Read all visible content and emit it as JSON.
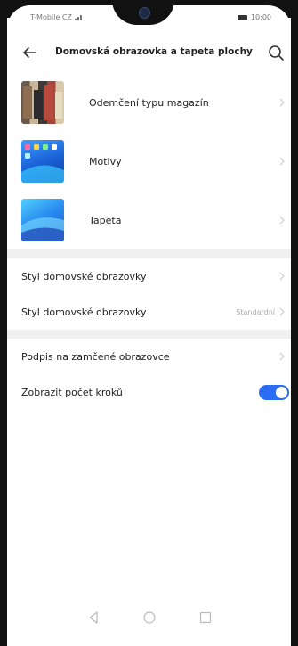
{
  "status_bar": {
    "carrier": "T-Mobile CZ",
    "time": "10:00"
  },
  "header": {
    "title": "Domovská obrazovka a tapeta plochy"
  },
  "items_with_images": [
    {
      "label": "Odemčení typu magazín",
      "icon": "magazine-thumbnail"
    },
    {
      "label": "Motivy",
      "icon": "themes-thumbnail"
    },
    {
      "label": "Tapeta",
      "icon": "wallpaper-thumbnail"
    }
  ],
  "home_section": [
    {
      "label": "Styl domovské obrazovky",
      "value": ""
    },
    {
      "label": "Styl domovské obrazovky",
      "value": "Standardní"
    }
  ],
  "lock_section": [
    {
      "label": "Podpis na zamčené obrazovce"
    },
    {
      "label": "Zobrazit počet kroků",
      "toggle": true
    }
  ],
  "colors": {
    "accent": "#2a6df4"
  },
  "navbar": {
    "icons": [
      "back-triangle-icon",
      "home-circle-icon",
      "recents-square-icon"
    ]
  }
}
